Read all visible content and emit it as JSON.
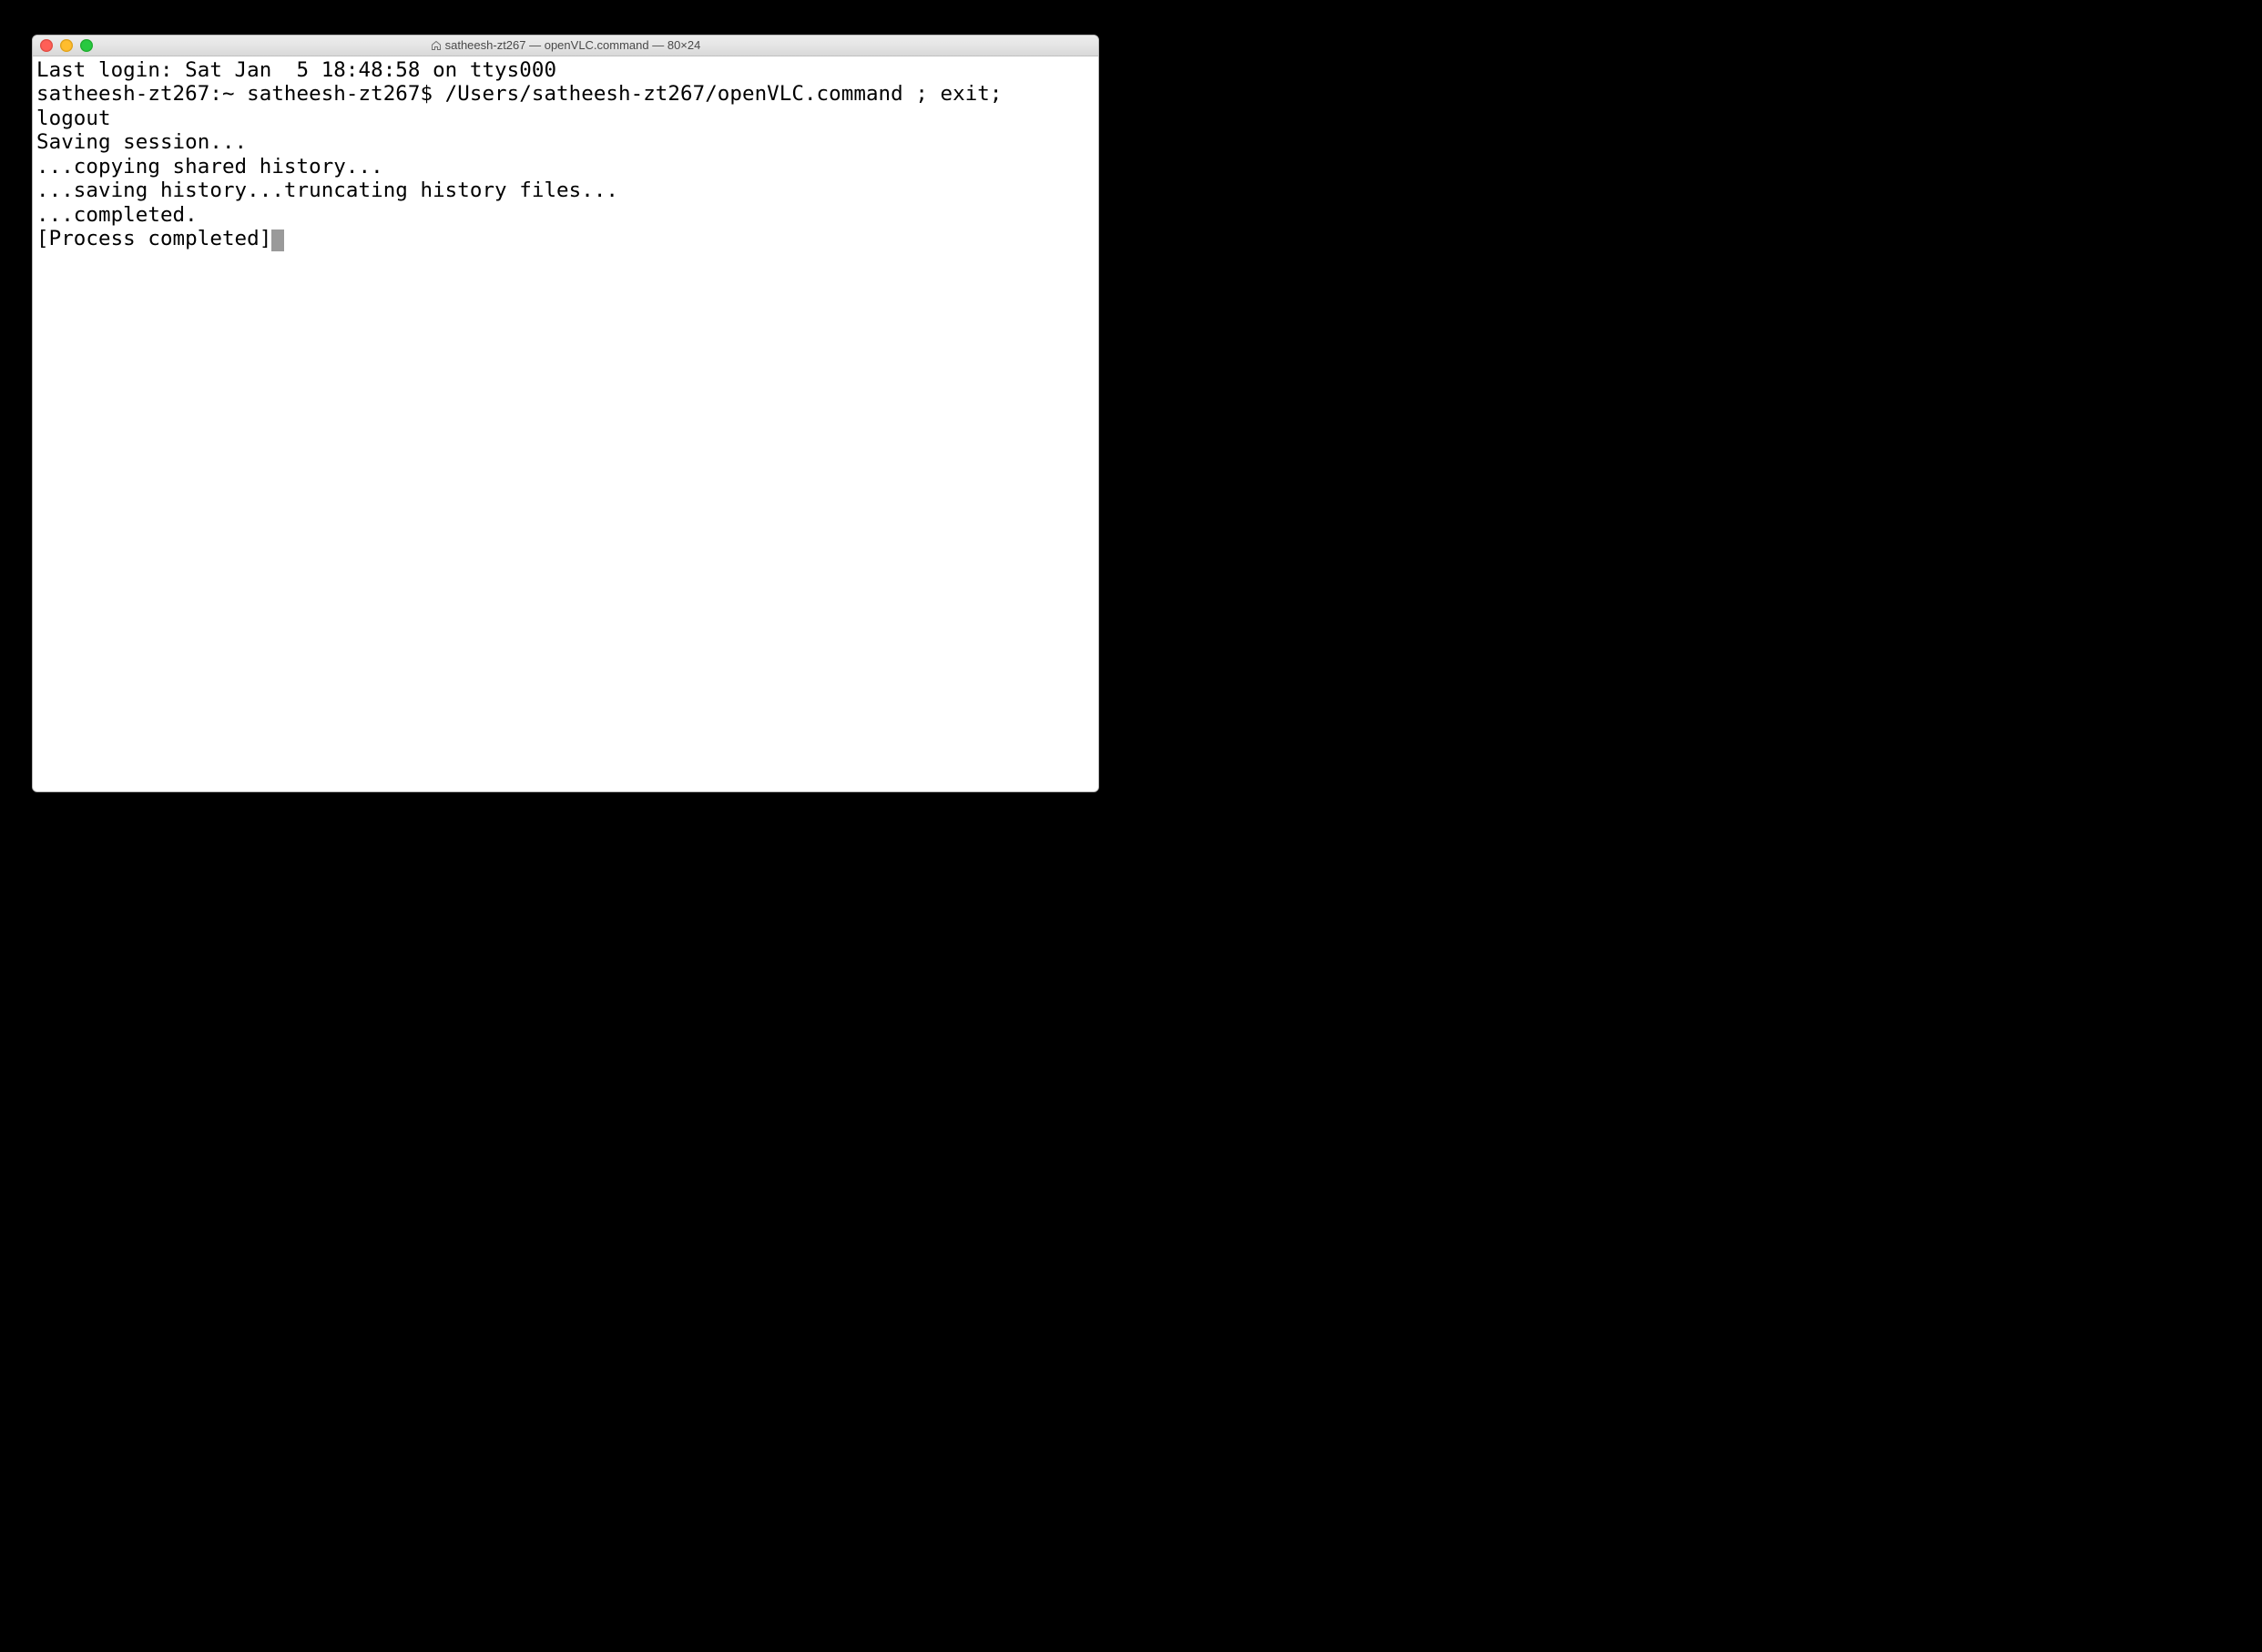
{
  "window": {
    "title": "satheesh-zt267 — openVLC.command — 80×24"
  },
  "terminal": {
    "lines": [
      "Last login: Sat Jan  5 18:48:58 on ttys000",
      "satheesh-zt267:~ satheesh-zt267$ /Users/satheesh-zt267/openVLC.command ; exit;",
      "logout",
      "Saving session...",
      "...copying shared history...",
      "...saving history...truncating history files...",
      "...completed.",
      ""
    ],
    "final_line": "[Process completed]"
  }
}
